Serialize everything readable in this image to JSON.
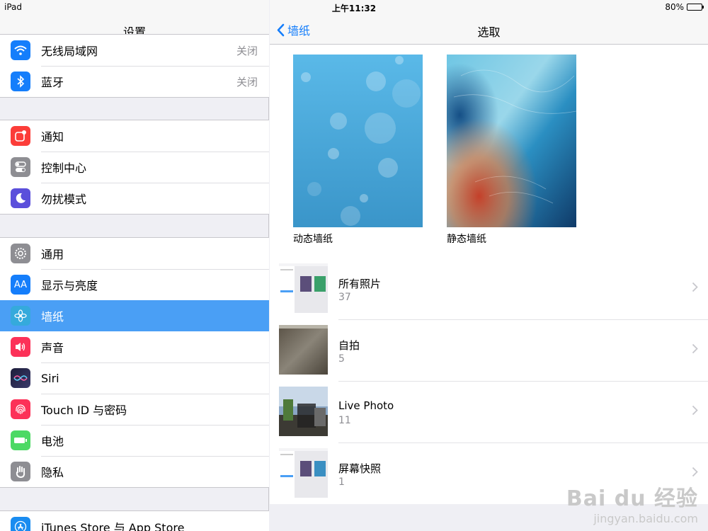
{
  "status": {
    "device": "iPad",
    "time": "上午11:32",
    "battery": "80%",
    "battery_level": 0.8
  },
  "left": {
    "title": "设置",
    "groups": [
      {
        "items": [
          {
            "label": "无线局域网",
            "value": "关闭",
            "icon": "wifi-icon",
            "color": "#157efb"
          },
          {
            "label": "蓝牙",
            "value": "关闭",
            "icon": "bluetooth-icon",
            "color": "#157efb"
          }
        ]
      },
      {
        "items": [
          {
            "label": "通知",
            "icon": "notifications-icon",
            "color": "#fc3d39"
          },
          {
            "label": "控制中心",
            "icon": "control-center-icon",
            "color": "#8e8e93"
          },
          {
            "label": "勿扰模式",
            "icon": "moon-icon",
            "color": "#5b4fdb"
          }
        ]
      },
      {
        "items": [
          {
            "label": "通用",
            "icon": "gear-icon",
            "color": "#8e8e93"
          },
          {
            "label": "显示与亮度",
            "icon": "display-brightness-icon",
            "color": "#157efb"
          },
          {
            "label": "墙纸",
            "icon": "wallpaper-icon",
            "color": "#35aadc",
            "selected": true
          },
          {
            "label": "声音",
            "icon": "speaker-icon",
            "color": "#fc3158"
          },
          {
            "label": "Siri",
            "icon": "siri-icon",
            "color": "#1d1d3a"
          },
          {
            "label": "Touch ID 与密码",
            "icon": "fingerprint-icon",
            "color": "#fc3158"
          },
          {
            "label": "电池",
            "icon": "battery-icon",
            "color": "#4cd964"
          },
          {
            "label": "隐私",
            "icon": "hand-icon",
            "color": "#8e8e93"
          }
        ]
      },
      {
        "items": [
          {
            "label": "iTunes Store 与 App Store",
            "icon": "app-store-icon",
            "color": "#1a8cf0"
          }
        ]
      }
    ]
  },
  "right": {
    "back_label": "墙纸",
    "title": "选取",
    "wallpapers": [
      {
        "caption": "动态墙纸"
      },
      {
        "caption": "静态墙纸"
      }
    ],
    "albums": [
      {
        "name": "所有照片",
        "count": "37"
      },
      {
        "name": "自拍",
        "count": "5"
      },
      {
        "name": "Live Photo",
        "count": "11"
      },
      {
        "name": "屏幕快照",
        "count": "1"
      }
    ]
  },
  "watermark": {
    "line1": "Bai du 经验",
    "line2": "jingyan.baidu.com"
  }
}
